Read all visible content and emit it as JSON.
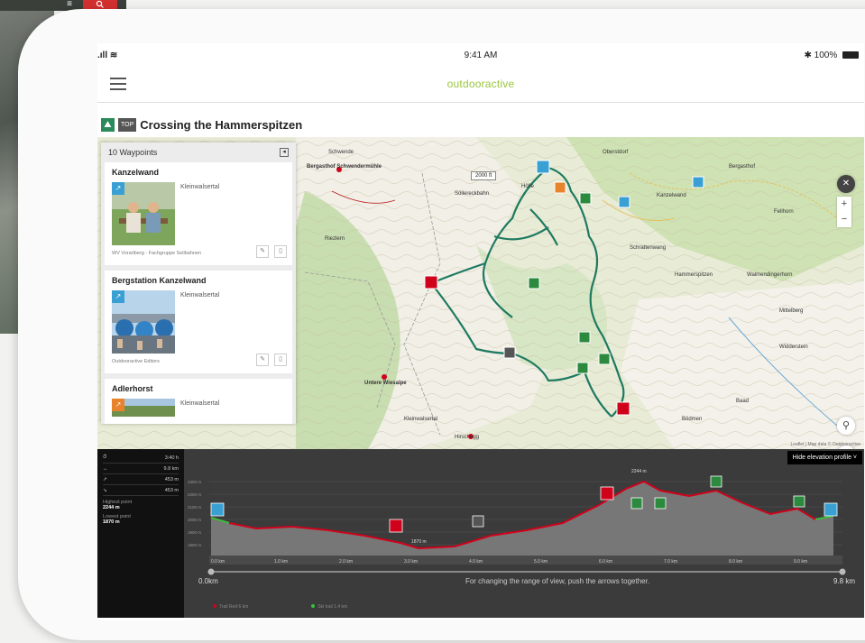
{
  "backdrop": {
    "menu_icon": "≡",
    "search_icon": "search-icon"
  },
  "status_bar": {
    "time": "9:41 AM",
    "battery": "100%",
    "signal": "signal-wifi-icon"
  },
  "header": {
    "brand": "outdooractive"
  },
  "tour": {
    "badge": "TOP",
    "title": "Crossing the Hammerspitzen"
  },
  "waypoints_panel": {
    "title": "10 Waypoints",
    "items": [
      {
        "name": "Kanzelwand",
        "region": "Kleinwalsertal",
        "credit": "WV Vorarlberg - Fachgruppe Seilbahnen"
      },
      {
        "name": "Bergstation Kanzelwand",
        "region": "Kleinwalsertal",
        "credit": "Outdooractive Editors"
      },
      {
        "name": "Adlerhorst",
        "region": "Kleinwalsertal",
        "credit": ""
      }
    ]
  },
  "map": {
    "labels": [
      "Schwende",
      "Bergasthof Schwendermühle",
      "Söllereckbahn",
      "Höfle",
      "Oberstdorf",
      "Bergasthof",
      "Kanzelwand",
      "Fellhorn",
      "Hammerspitzen",
      "Widderstein",
      "Untere Wiesalpe",
      "Kleinwalsertal",
      "Walmendingerhorn",
      "Riezlern",
      "Hirschegg",
      "Mittelberg",
      "Baad",
      "Bödmen",
      "Schrattenwang"
    ],
    "scale": "2000 ft",
    "copyright": "Leaflet | Map data © Outdooractive"
  },
  "elevation": {
    "hide_button": "Hide elevation profile ˅",
    "stats": [
      {
        "label": "⏱",
        "value": "3:40 h"
      },
      {
        "label": "↔",
        "value": "9.8 km"
      },
      {
        "label": "↗",
        "value": "453 m"
      },
      {
        "label": "↘",
        "value": "453 m"
      }
    ],
    "highest_label": "Highest point",
    "highest_value": "2244 m",
    "lowest_label": "Lowest point",
    "lowest_value": "1870 m",
    "peak_label": "2244 m",
    "low_label": "1870 m",
    "range_start": "0.0km",
    "range_end": "9.8 km",
    "range_hint": "For changing the range of view, push the arrows together.",
    "legend": [
      "Trail Red 6 km",
      "Ski trail 1.4 km"
    ],
    "x_ticks": [
      "0.0 km",
      "1.0 km",
      "2.0 km",
      "3.0 km",
      "4.0 km",
      "5.0 km",
      "6.0 km",
      "7.0 km",
      "8.0 km",
      "9.0 km"
    ],
    "y_ticks": [
      "2300 m",
      "2200 m",
      "2100 m",
      "2000 m",
      "1900 m",
      "1800 m"
    ]
  }
}
